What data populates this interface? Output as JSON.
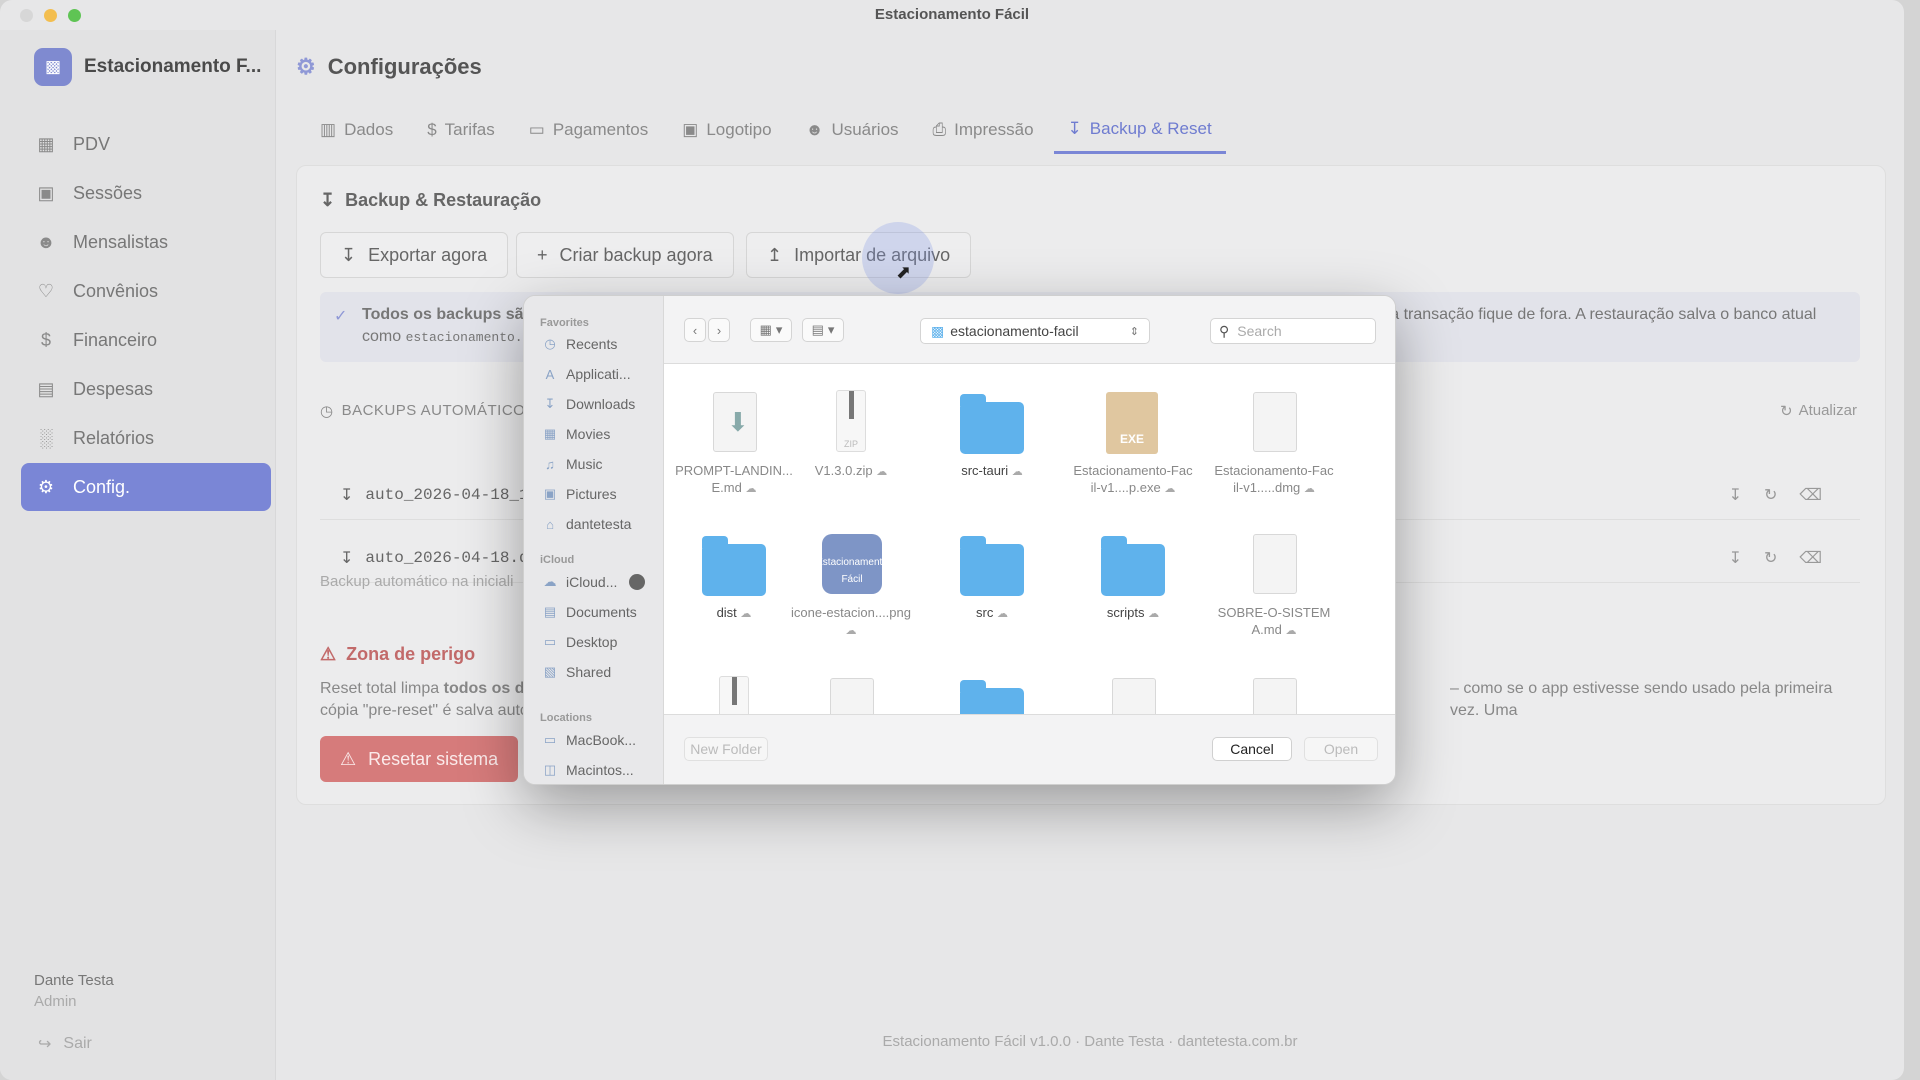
{
  "window": {
    "title": "Estacionamento Fácil"
  },
  "sidebar": {
    "brand": "Estacionamento F...",
    "brand_icon": "car-icon",
    "items": [
      {
        "label": "PDV",
        "icon": "grid-icon"
      },
      {
        "label": "Sessões",
        "icon": "car-icon"
      },
      {
        "label": "Mensalistas",
        "icon": "users-icon"
      },
      {
        "label": "Convênios",
        "icon": "handshake-icon"
      },
      {
        "label": "Financeiro",
        "icon": "dollar-icon"
      },
      {
        "label": "Despesas",
        "icon": "receipt-icon"
      },
      {
        "label": "Relatórios",
        "icon": "bar-chart-icon"
      },
      {
        "label": "Config.",
        "icon": "gear-icon",
        "active": true
      }
    ],
    "user_name": "Dante Testa",
    "user_role": "Admin",
    "logout": "Sair"
  },
  "page": {
    "title": "Configurações",
    "tabs": [
      {
        "label": "Dados",
        "icon": "building-icon"
      },
      {
        "label": "Tarifas",
        "icon": "dollar-icon"
      },
      {
        "label": "Pagamentos",
        "icon": "card-icon"
      },
      {
        "label": "Logotipo",
        "icon": "image-icon"
      },
      {
        "label": "Usuários",
        "icon": "users-icon"
      },
      {
        "label": "Impressão",
        "icon": "printer-icon"
      },
      {
        "label": "Backup & Reset",
        "icon": "download-tray-icon",
        "active": true
      }
    ],
    "backup_title": "Backup & Restauração",
    "buttons": {
      "export": "Exportar agora",
      "create": "Criar backup agora",
      "import": "Importar de arquivo"
    },
    "notice_bold": "Todos os backups são",
    "notice_right": "uma transação fique de fora. A restauração salva o banco atual",
    "notice_line2_prefix": "como",
    "notice_code": "estacionamento.",
    "auto_title": "BACKUPS AUTOMÁTICO",
    "refresh": "Atualizar",
    "backups": [
      "auto_2026-04-18_1",
      "auto_2026-04-18.d"
    ],
    "auto_note": "Backup automático na iniciali",
    "danger_title": "Zona de perigo",
    "danger_text_prefix": "Reset total limpa",
    "danger_text_bold": "todos os da",
    "danger_text_right": "– como se o app estivesse sendo usado pela primeira vez. Uma",
    "danger_text_line2": "cópia \"pre-reset\" é salva autc",
    "reset_button": "Resetar sistema",
    "footer": "Estacionamento Fácil v1.0.0 · Dante Testa · dantetesta.com.br"
  },
  "dialog": {
    "favorites_label": "Favorites",
    "favorites": [
      {
        "label": "Recents",
        "icon": "clock-icon"
      },
      {
        "label": "Applicati...",
        "icon": "apps-icon"
      },
      {
        "label": "Downloads",
        "icon": "download-icon"
      },
      {
        "label": "Movies",
        "icon": "film-icon"
      },
      {
        "label": "Music",
        "icon": "music-icon"
      },
      {
        "label": "Pictures",
        "icon": "photo-icon"
      },
      {
        "label": "dantetesta",
        "icon": "home-icon"
      }
    ],
    "icloud_label": "iCloud",
    "icloud": [
      {
        "label": "iCloud...",
        "icon": "cloud-icon"
      },
      {
        "label": "Documents",
        "icon": "doc-icon"
      },
      {
        "label": "Desktop",
        "icon": "desktop-icon"
      },
      {
        "label": "Shared",
        "icon": "shared-folder-icon"
      }
    ],
    "locations_label": "Locations",
    "locations": [
      {
        "label": "MacBook...",
        "icon": "laptop-icon"
      },
      {
        "label": "Macintos...",
        "icon": "disk-icon"
      }
    ],
    "path": "estacionamento-facil",
    "search_placeholder": "Search",
    "files": [
      {
        "name": "PROMPT-LANDIN...E.md",
        "kind": "doc",
        "cloud": true
      },
      {
        "name": "V1.3.0.zip",
        "kind": "zip",
        "cloud": true
      },
      {
        "name": "src-tauri",
        "kind": "folder",
        "cloud": true
      },
      {
        "name": "Estacionamento-Facil-v1....p.exe",
        "kind": "exe",
        "cloud": true
      },
      {
        "name": "Estacionamento-Facil-v1.....dmg",
        "kind": "doc",
        "cloud": true
      },
      {
        "name": "dist",
        "kind": "folder",
        "cloud": true
      },
      {
        "name": "icone-estacion....png",
        "kind": "app",
        "cloud": true
      },
      {
        "name": "src",
        "kind": "folder",
        "cloud": true
      },
      {
        "name": "scripts",
        "kind": "folder",
        "cloud": true
      },
      {
        "name": "SOBRE-O-SISTEMA.md",
        "kind": "doc",
        "cloud": true
      }
    ],
    "exe_label": "EXE",
    "zip_label": "ZIP",
    "app_label": "Estacionamento Fácil",
    "new_folder": "New Folder",
    "cancel": "Cancel",
    "open": "Open"
  }
}
